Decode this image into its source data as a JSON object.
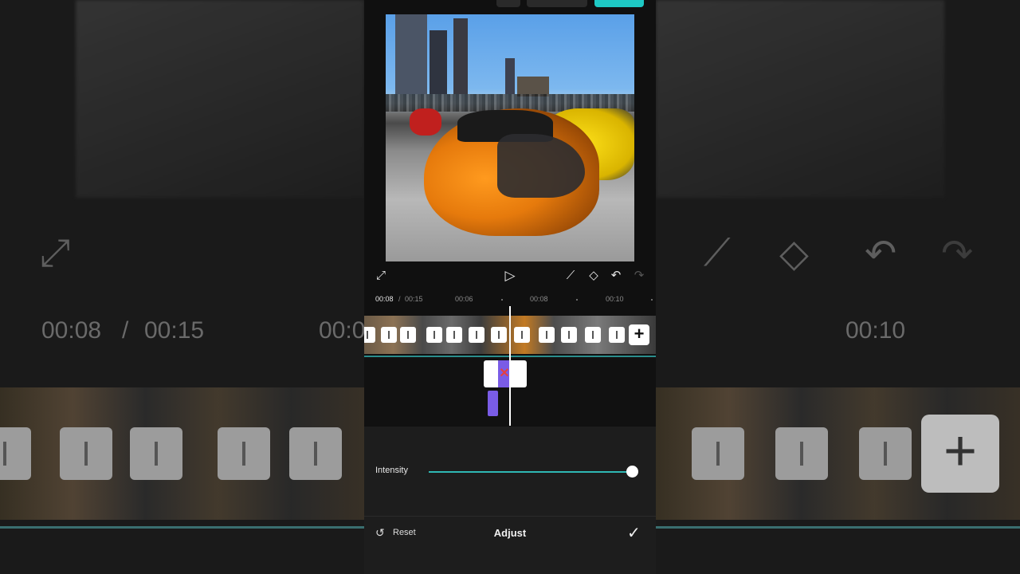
{
  "app": {
    "accent_color": "#1ec8c4",
    "clip_color": "#7a5ce6"
  },
  "backdrop": {
    "left_time": "00:08",
    "left_sep": "/",
    "left_total": "00:15",
    "left_clip_time": "00:0",
    "right_mark": "00:10"
  },
  "controls": {
    "fullscreen_icon": "fullscreen-icon",
    "play_icon": "play-icon",
    "curve_icon": "keyframe-curve-icon",
    "keyframe_icon": "keyframe-icon",
    "undo_icon": "undo-icon",
    "redo_icon": "redo-icon"
  },
  "ruler": {
    "current_time": "00:08",
    "separator": "/",
    "total_time": "00:15",
    "marks": [
      "00:06",
      "00:08",
      "00:10"
    ]
  },
  "timeline": {
    "add_clip_label": "+"
  },
  "adjust_panel": {
    "intensity_label": "Intensity",
    "intensity_value": 1.0,
    "reset_label": "Reset",
    "title": "Adjust"
  }
}
